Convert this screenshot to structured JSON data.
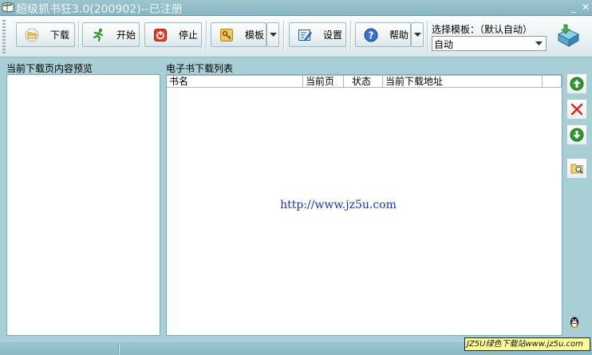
{
  "window": {
    "title": "超级抓书狂3.0(200902)--已注册",
    "minimize_glyph": "_",
    "close_glyph": "✕"
  },
  "toolbar": {
    "download_label": "下载",
    "start_label": "开始",
    "stop_label": "停止",
    "template_label": "模板",
    "settings_label": "设置",
    "help_label": "帮助",
    "template_select_label": "选择模板：（默认自动）",
    "template_select_value": "自动"
  },
  "preview": {
    "label": "当前下载页内容预览"
  },
  "ebook_list": {
    "label": "电子书下载列表",
    "columns": [
      "书名",
      "当前页",
      "状态",
      "当前下载地址",
      ""
    ],
    "watermark": "http://www.jz5u.com"
  },
  "statusbar": {
    "badge_text": "JZ5U绿色下载站www.jz5u.com"
  },
  "colors": {
    "accent_green": "#2f9a2f",
    "delete_red": "#d8261c",
    "link_blue": "#1a35b0"
  }
}
